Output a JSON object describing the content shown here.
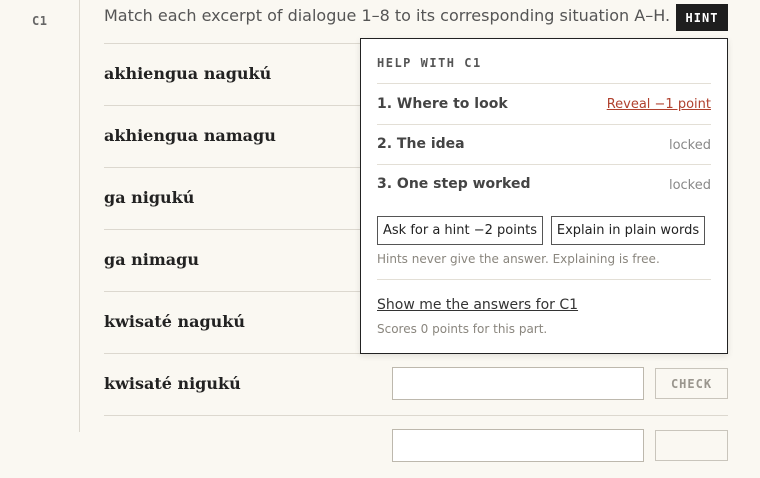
{
  "question": {
    "id": "C1",
    "instruction": "Match each excerpt of dialogue 1–8 to its corresponding situation A–H.",
    "hint_button": "HINT"
  },
  "rows": [
    {
      "label": "akhiengua nagukú"
    },
    {
      "label": "akhiengua namagu"
    },
    {
      "label": "ga nigukú"
    },
    {
      "label": "ga nimagu"
    },
    {
      "label": "kwisaté nagukú"
    },
    {
      "label": "kwisaté nigukú",
      "check": "CHECK"
    }
  ],
  "help": {
    "title": "HELP WITH C1",
    "steps": [
      {
        "label": "1. Where to look",
        "action": "Reveal −1 point"
      },
      {
        "label": "2. The idea",
        "action": "locked"
      },
      {
        "label": "3. One step worked",
        "action": "locked"
      }
    ],
    "ask_hint": "Ask for a hint −2 points",
    "explain": "Explain in plain words",
    "note": "Hints never give the answer. Explaining is free.",
    "show_answers": "Show me the answers for C1",
    "show_answers_note": "Scores 0 points for this part."
  }
}
